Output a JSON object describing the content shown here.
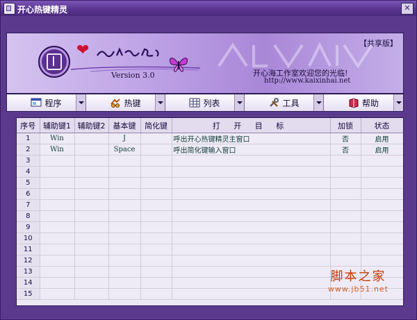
{
  "window": {
    "title": "开心热键精灵"
  },
  "banner": {
    "edition": "【共享版】",
    "version": "Version 3.0",
    "welcome": "开心海工作室欢迎您的光临!",
    "url": "http://www.kaixinhai.net"
  },
  "menu": [
    {
      "label": "程序",
      "icon": "program-icon"
    },
    {
      "label": "热键",
      "icon": "hotkey-icon"
    },
    {
      "label": "列表",
      "icon": "list-icon"
    },
    {
      "label": "工具",
      "icon": "tools-icon"
    },
    {
      "label": "帮助",
      "icon": "help-icon"
    }
  ],
  "table": {
    "headers": [
      "序号",
      "辅助键1",
      "辅助键2",
      "基本键",
      "简化键",
      "打 开 目 标",
      "加锁",
      "状态"
    ],
    "rows": [
      {
        "num": "1",
        "mod1": "Win",
        "mod2": "",
        "key": "J",
        "simple": "",
        "target": "呼出开心热键精灵主窗口",
        "lock": "否",
        "status": "启用"
      },
      {
        "num": "2",
        "mod1": "Win",
        "mod2": "",
        "key": "Space",
        "simple": "",
        "target": "呼出简化键输入窗口",
        "lock": "否",
        "status": "启用"
      },
      {
        "num": "3",
        "mod1": "",
        "mod2": "",
        "key": "",
        "simple": "",
        "target": "",
        "lock": "",
        "status": ""
      },
      {
        "num": "4",
        "mod1": "",
        "mod2": "",
        "key": "",
        "simple": "",
        "target": "",
        "lock": "",
        "status": ""
      },
      {
        "num": "5",
        "mod1": "",
        "mod2": "",
        "key": "",
        "simple": "",
        "target": "",
        "lock": "",
        "status": ""
      },
      {
        "num": "6",
        "mod1": "",
        "mod2": "",
        "key": "",
        "simple": "",
        "target": "",
        "lock": "",
        "status": ""
      },
      {
        "num": "7",
        "mod1": "",
        "mod2": "",
        "key": "",
        "simple": "",
        "target": "",
        "lock": "",
        "status": ""
      },
      {
        "num": "8",
        "mod1": "",
        "mod2": "",
        "key": "",
        "simple": "",
        "target": "",
        "lock": "",
        "status": ""
      },
      {
        "num": "9",
        "mod1": "",
        "mod2": "",
        "key": "",
        "simple": "",
        "target": "",
        "lock": "",
        "status": ""
      },
      {
        "num": "10",
        "mod1": "",
        "mod2": "",
        "key": "",
        "simple": "",
        "target": "",
        "lock": "",
        "status": ""
      },
      {
        "num": "11",
        "mod1": "",
        "mod2": "",
        "key": "",
        "simple": "",
        "target": "",
        "lock": "",
        "status": ""
      },
      {
        "num": "12",
        "mod1": "",
        "mod2": "",
        "key": "",
        "simple": "",
        "target": "",
        "lock": "",
        "status": ""
      },
      {
        "num": "13",
        "mod1": "",
        "mod2": "",
        "key": "",
        "simple": "",
        "target": "",
        "lock": "",
        "status": ""
      },
      {
        "num": "14",
        "mod1": "",
        "mod2": "",
        "key": "",
        "simple": "",
        "target": "",
        "lock": "",
        "status": ""
      },
      {
        "num": "15",
        "mod1": "",
        "mod2": "",
        "key": "",
        "simple": "",
        "target": "",
        "lock": "",
        "status": ""
      }
    ]
  },
  "watermark": {
    "name": "脚本之家",
    "url": "www.jb51.net"
  },
  "colors": {
    "window_frame": "#5b3a8e",
    "banner": "#bea3e6",
    "grid_bg": "#ece8f4",
    "text_teal": "#0d3b3b"
  }
}
